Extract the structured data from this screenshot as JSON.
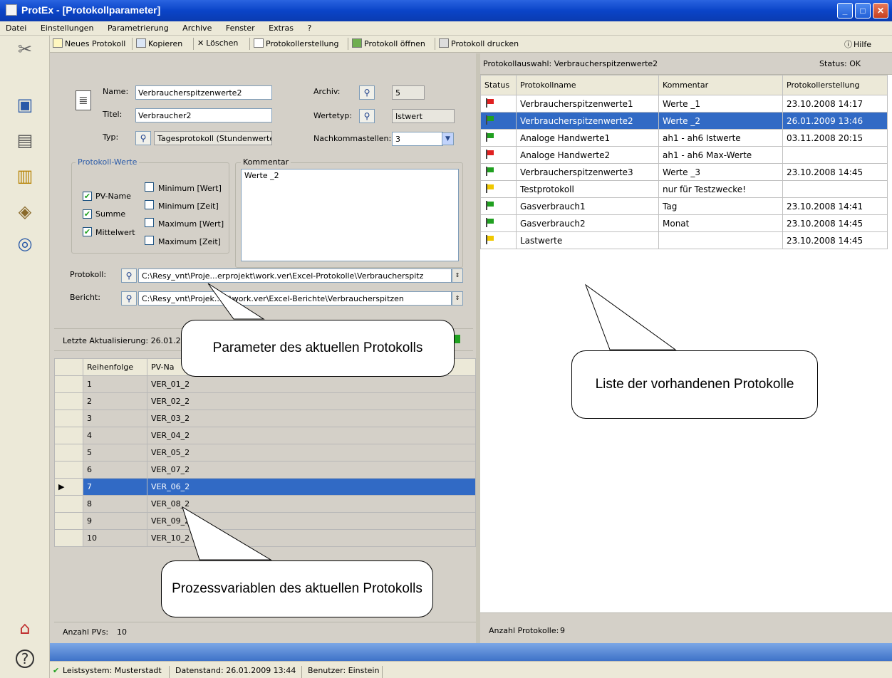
{
  "window": {
    "app": "ProtEx",
    "title": "ProtEx - [Protokollparameter]"
  },
  "menu": [
    "Datei",
    "Einstellungen",
    "Parametrierung",
    "Archive",
    "Fenster",
    "Extras",
    "?"
  ],
  "toolbar": {
    "new": "Neues Protokoll",
    "copy": "Kopieren",
    "delete": "Löschen",
    "create": "Protokollerstellung",
    "open": "Protokoll öffnen",
    "print": "Protokoll drucken",
    "help": "Hilfe"
  },
  "form": {
    "name_label": "Name:",
    "name_value": "Verbraucherspitzenwerte2",
    "title_label": "Titel:",
    "title_value": "Verbraucher2",
    "type_label": "Typ:",
    "type_value": "Tagesprotokoll (Stundenwerte)",
    "archive_label": "Archiv:",
    "archive_value": "5",
    "valuetype_label": "Wertetyp:",
    "valuetype_value": "Istwert",
    "decimals_label": "Nachkommastellen:",
    "decimals_value": "3",
    "values_group": "Protokoll-Werte",
    "cb_pvname": "PV-Name",
    "cb_summe": "Summe",
    "cb_mittelwert": "Mittelwert",
    "cb_min_wert": "Minimum [Wert]",
    "cb_min_zeit": "Minimum [Zeit]",
    "cb_max_wert": "Maximum [Wert]",
    "cb_max_zeit": "Maximum [Zeit]",
    "comment_group": "Kommentar",
    "comment_value": "Werte _2",
    "protokoll_label": "Protokoll:",
    "protokoll_path": "C:\\Resy_vnt\\Proje...erprojekt\\work.ver\\Excel-Protokolle\\Verbraucherspitz",
    "bericht_label": "Bericht:",
    "bericht_path": "C:\\Resy_vnt\\Projek...kt\\work.ver\\Excel-Berichte\\Verbraucherspitzen",
    "last_update": "Letzte Aktualisierung: 26.01.20"
  },
  "pv_table": {
    "headers": [
      "Reihenfolge",
      "PV-Na"
    ],
    "rows": [
      [
        "1",
        "VER_01_2"
      ],
      [
        "2",
        "VER_02_2"
      ],
      [
        "3",
        "VER_03_2"
      ],
      [
        "4",
        "VER_04_2"
      ],
      [
        "5",
        "VER_05_2"
      ],
      [
        "6",
        "VER_07_2"
      ],
      [
        "7",
        "VER_06_2"
      ],
      [
        "8",
        "VER_08_2"
      ],
      [
        "9",
        "VER_09_2"
      ],
      [
        "10",
        "VER_10_2"
      ]
    ],
    "count_label": "Anzahl PVs:",
    "count_value": "10"
  },
  "protocol_list": {
    "header_left": "Protokollauswahl: Verbraucherspitzenwerte2",
    "header_right": "Status: OK",
    "headers": [
      "Status",
      "Protokollname",
      "Kommentar",
      "Protokollerstellung"
    ],
    "rows": [
      {
        "flag": "#e02020",
        "name": "Verbraucherspitzenwerte1",
        "comment": "Werte _1",
        "date": "23.10.2008 14:17"
      },
      {
        "flag": "#20a020",
        "name": "Verbraucherspitzenwerte2",
        "comment": "Werte _2",
        "date": "26.01.2009 13:46"
      },
      {
        "flag": "#20a020",
        "name": "Analoge Handwerte1",
        "comment": "ah1 - ah6 Istwerte",
        "date": "03.11.2008 20:15"
      },
      {
        "flag": "#e02020",
        "name": "Analoge Handwerte2",
        "comment": "ah1 - ah6 Max-Werte",
        "date": ""
      },
      {
        "flag": "#20a020",
        "name": "Verbraucherspitzenwerte3",
        "comment": "Werte _3",
        "date": "23.10.2008 14:45"
      },
      {
        "flag": "#f0c800",
        "name": "Testprotokoll",
        "comment": "nur für Testzwecke!",
        "date": ""
      },
      {
        "flag": "#20a020",
        "name": "Gasverbrauch1",
        "comment": "Tag",
        "date": "23.10.2008 14:41"
      },
      {
        "flag": "#20a020",
        "name": "Gasverbrauch2",
        "comment": "Monat",
        "date": "23.10.2008 14:45"
      },
      {
        "flag": "#f0c800",
        "name": "Lastwerte",
        "comment": "",
        "date": "23.10.2008 14:45"
      }
    ],
    "count_label": "Anzahl Protokolle:",
    "count_value": "9"
  },
  "callouts": {
    "params": "Parameter des aktuellen Protokolls",
    "list": "Liste der vorhandenen Protokolle",
    "pvs": "Prozessvariablen des aktuellen Protokolls"
  },
  "status": {
    "system": "Leistsystem: Musterstadt",
    "data": "Datenstand: 26.01.2009 13:44",
    "user": "Benutzer: Einstein"
  }
}
